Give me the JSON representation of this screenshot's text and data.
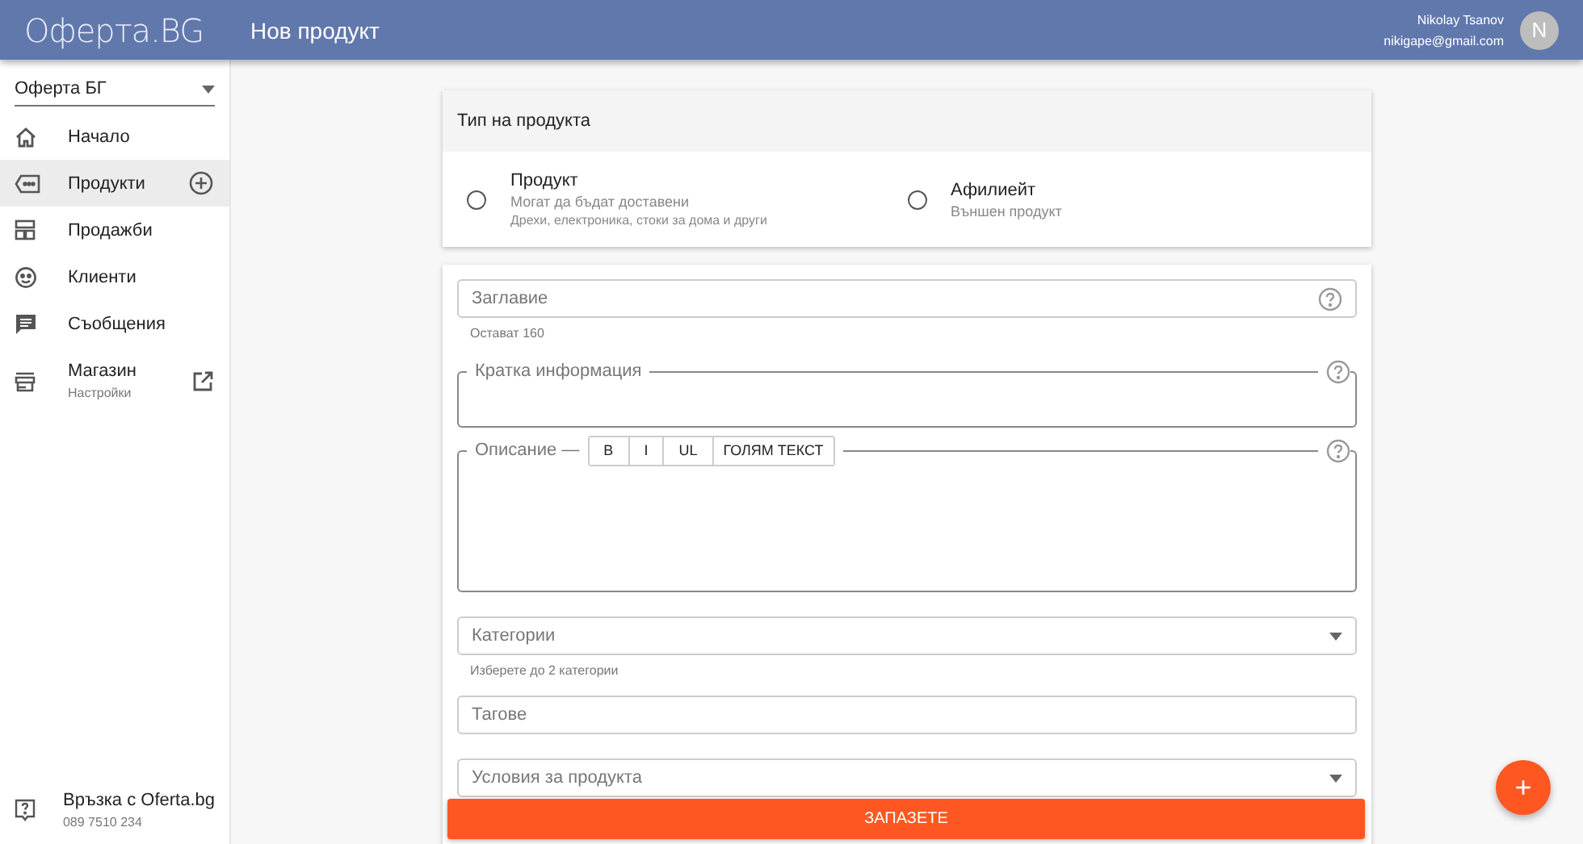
{
  "header": {
    "logo": "Оферта.BG",
    "title": "Нов продукт",
    "user_name": "Nikolay Tsanov",
    "user_email": "nikigape@gmail.com",
    "avatar": "N"
  },
  "sidebar": {
    "store_select": "Оферта БГ",
    "items": [
      {
        "label": "Начало",
        "selected": false
      },
      {
        "label": "Продукти",
        "selected": true
      },
      {
        "label": "Продажби",
        "selected": false
      },
      {
        "label": "Клиенти",
        "selected": false
      },
      {
        "label": "Съобщения",
        "selected": false
      },
      {
        "label": "Магазин",
        "sublabel": "Настройки",
        "selected": false
      }
    ],
    "footer": {
      "title": "Връзка с Oferta.bg",
      "subtitle": "089 7510 234"
    }
  },
  "product_type": {
    "title": "Тип на продукта",
    "options": [
      {
        "title": "Продукт",
        "lines": [
          "Могат да бъдат доставени",
          "Дрехи, електроника, стоки за дома и други"
        ],
        "selected": false
      },
      {
        "title": "Афилиейт",
        "lines": [
          "Външен продукт"
        ],
        "selected": false
      }
    ]
  },
  "form": {
    "fields": [
      {
        "kind": "text",
        "label": "Заглавие",
        "helper": "Остават 160",
        "help": true
      },
      {
        "kind": "textarea",
        "label": "Кратка информация",
        "help": true
      },
      {
        "kind": "editor",
        "label": "Описание —",
        "toolbar": [
          "B",
          "I",
          "UL",
          "ГОЛЯМ ТЕКСТ"
        ],
        "help": true
      },
      {
        "kind": "select",
        "label": "Категории",
        "helper": "Изберете до 2 категории"
      },
      {
        "kind": "text",
        "label": "Тагове"
      },
      {
        "kind": "select",
        "label": "Условия за продукта"
      }
    ],
    "save": "ЗАПАЗЕТЕ"
  },
  "fab": "+"
}
